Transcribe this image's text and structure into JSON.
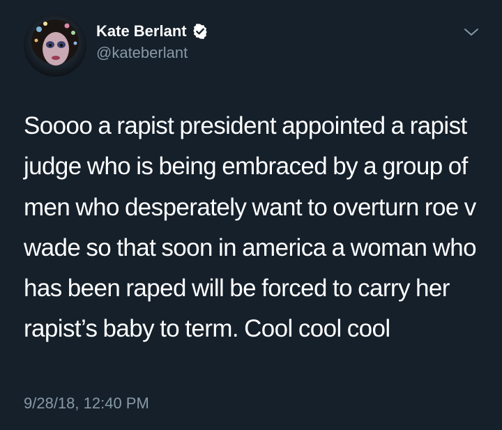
{
  "tweet": {
    "display_name": "Kate Berlant",
    "handle": "@kateberlant",
    "verified": true,
    "text": "Soooo a rapist president appointed a rapist judge who is being embraced by a group of men who desperately want to overturn roe v wade so that soon in america a woman who has been raped will be forced to carry her rapist’s baby to term. Cool cool cool",
    "timestamp": "9/28/18, 12:40 PM"
  },
  "icons": {
    "verified": "verified-badge-icon",
    "menu": "chevron-down-icon"
  },
  "colors": {
    "background": "#15202b",
    "text": "#ffffff",
    "secondary": "#8899a6",
    "verified_badge": "#ffffff"
  }
}
